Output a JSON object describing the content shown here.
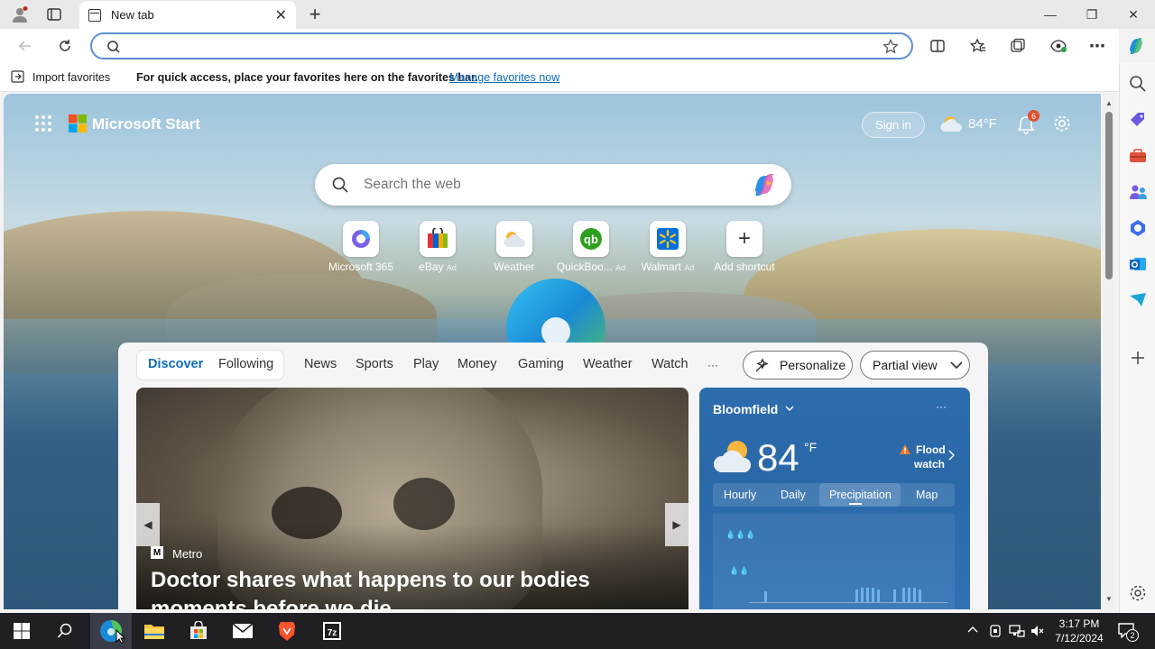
{
  "browser": {
    "tab_title": "New tab",
    "tab_close": "✕",
    "new_tab": "+",
    "window_controls": {
      "minimize": "—",
      "restore": "❐",
      "close": "✕"
    },
    "address_placeholder": "",
    "favorites_bar": {
      "import_label": "Import favorites",
      "hint": "For quick access, place your favorites here on the favorites bar.",
      "manage_link": "Manage favorites now"
    }
  },
  "start": {
    "brand": "Microsoft Start",
    "sign_in": "Sign in",
    "header_temp": "84°F",
    "notification_count": "6",
    "search_placeholder": "Search the web",
    "shortcuts": [
      {
        "label": "Microsoft 365",
        "ad": ""
      },
      {
        "label": "eBay",
        "ad": "Ad"
      },
      {
        "label": "Weather",
        "ad": ""
      },
      {
        "label": "QuickBoo...",
        "ad": "Ad"
      },
      {
        "label": "Walmart",
        "ad": "Ad"
      },
      {
        "label": "Add shortcut",
        "ad": ""
      }
    ],
    "feed_tabs": [
      "Discover",
      "Following"
    ],
    "nav": [
      "News",
      "Sports",
      "Play",
      "Money",
      "Gaming",
      "Weather",
      "Watch",
      "···"
    ],
    "personalize": "Personalize",
    "view_select": "Partial view",
    "hero": {
      "source": "Metro",
      "headline": "Doctor shares what happens to our bodies moments before we die"
    },
    "weather_card": {
      "location": "Bloomfield",
      "temp": "84",
      "unit": "°F",
      "alert_line1": "Flood",
      "alert_line2": "watch",
      "tabs": [
        "Hourly",
        "Daily",
        "Precipitation",
        "Map"
      ],
      "active_tab": "Precipitation",
      "more": "···"
    }
  },
  "taskbar": {
    "time": "3:17 PM",
    "date": "7/12/2024",
    "notifications": "2"
  },
  "colors": {
    "accent": "#0f6cbd",
    "address_border": "#5b8fd6",
    "weather_card": "#2d6cad"
  }
}
